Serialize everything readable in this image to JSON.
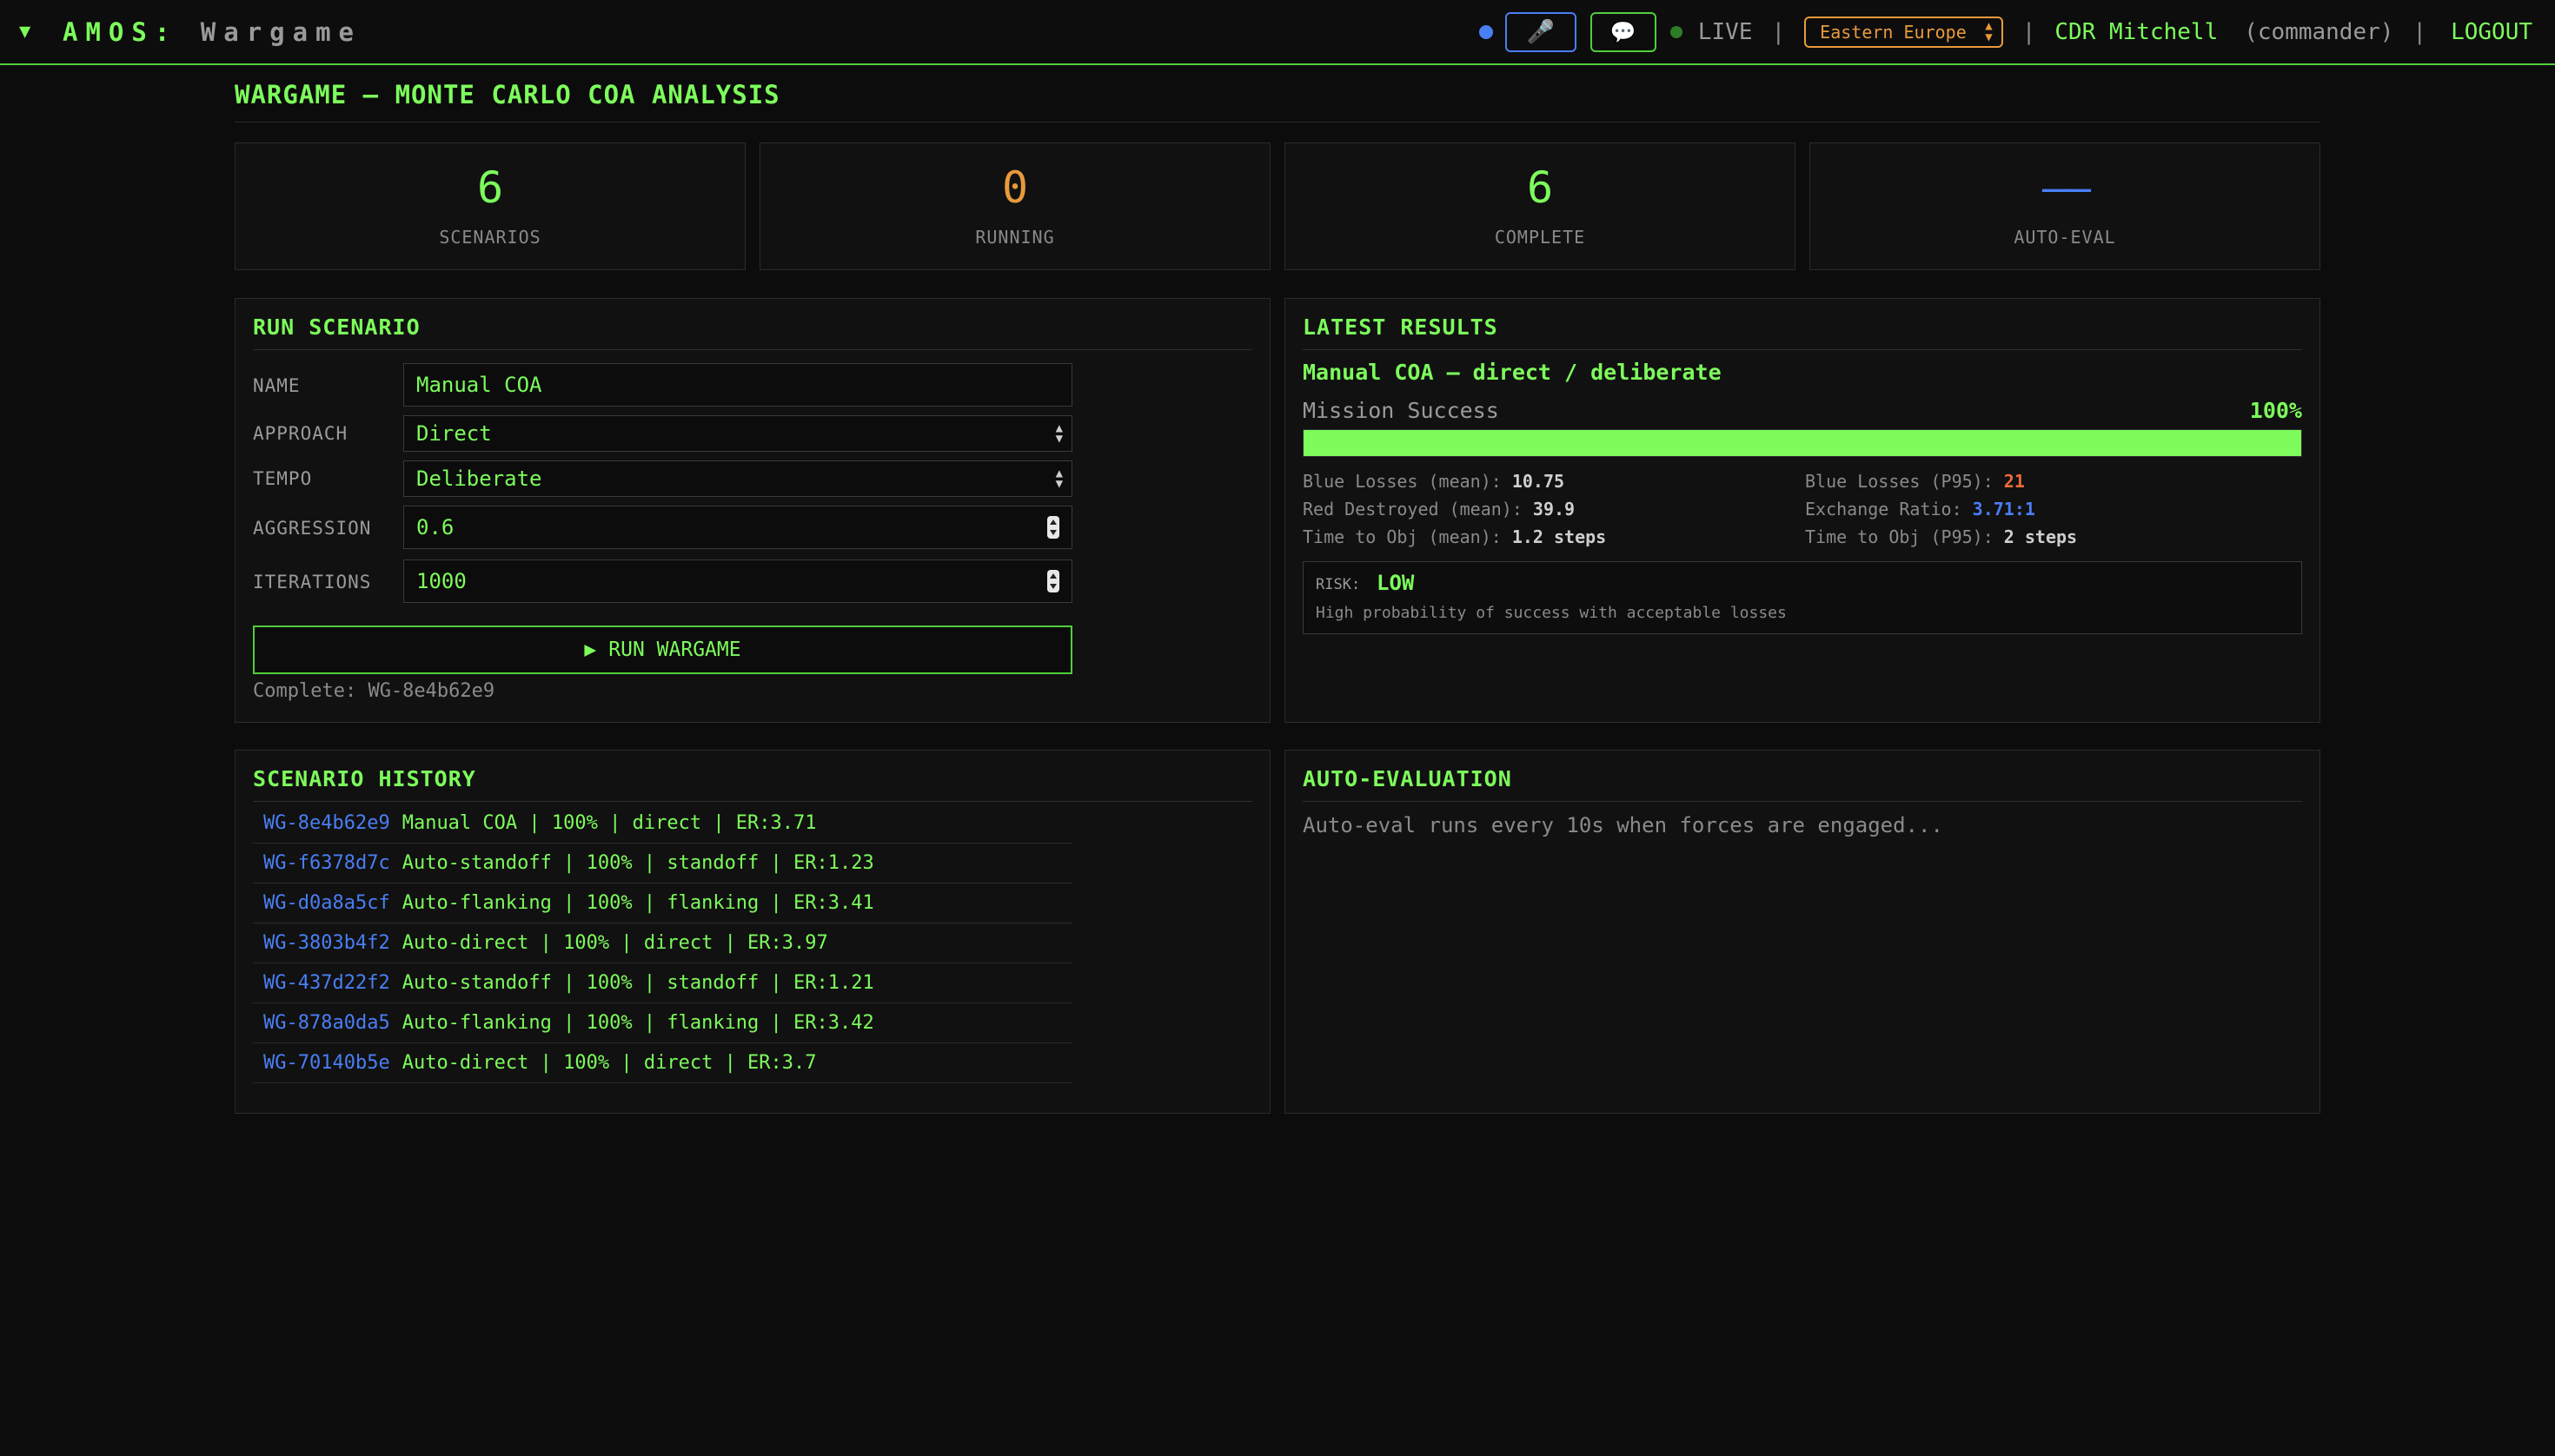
{
  "header": {
    "brand_name": "AMOS:",
    "brand_section": "Wargame",
    "live_label": "LIVE",
    "separator": "|",
    "region": "Eastern Europe",
    "user": "CDR Mitchell",
    "role": "(commander)",
    "logout_label": "LOGOUT",
    "collapse_glyph": "▼",
    "mic_glyph": "🎤",
    "chat_glyph": "💬"
  },
  "page": {
    "title": "WARGAME — MONTE CARLO COA ANALYSIS"
  },
  "stats": [
    {
      "value": "6",
      "label": "SCENARIOS",
      "color": "#7dfc5c"
    },
    {
      "value": "0",
      "label": "RUNNING",
      "color": "#e89a3c"
    },
    {
      "value": "6",
      "label": "COMPLETE",
      "color": "#7dfc5c"
    },
    {
      "value": "——",
      "label": "AUTO-EVAL",
      "color": "#4a7ef5"
    }
  ],
  "run": {
    "title": "RUN SCENARIO",
    "name_label": "NAME",
    "name_value": "Manual COA",
    "approach_label": "APPROACH",
    "approach_value": "Direct",
    "tempo_label": "TEMPO",
    "tempo_value": "Deliberate",
    "aggression_label": "AGGRESSION",
    "aggression_value": "0.6",
    "iterations_label": "ITERATIONS",
    "iterations_value": "1000",
    "run_glyph": "▶",
    "run_label": "RUN WARGAME",
    "status": "Complete: WG-8e4b62e9"
  },
  "results": {
    "title": "LATEST RESULTS",
    "coa": "Manual COA — direct / deliberate",
    "mission_label": "Mission Success",
    "mission_value": "100%",
    "mission_fraction": 1.0,
    "metrics": {
      "blue_mean_label": "Blue Losses (mean):",
      "blue_mean_value": "10.75",
      "blue_p95_label": "Blue Losses (P95):",
      "blue_p95_value": "21",
      "red_label": "Red Destroyed (mean):",
      "red_value": "39.9",
      "er_label": "Exchange Ratio:",
      "er_value": "3.71:1",
      "tto_mean_label": "Time to Obj (mean):",
      "tto_mean_value": "1.2 steps",
      "tto_p95_label": "Time to Obj (P95):",
      "tto_p95_value": "2 steps"
    },
    "risk_key": "RISK:",
    "risk_value": "LOW",
    "risk_desc": "High probability of success with acceptable losses"
  },
  "history": {
    "title": "SCENARIO HISTORY",
    "rows": [
      {
        "id": "WG-8e4b62e9",
        "text": "Manual COA | 100% | direct | ER:3.71"
      },
      {
        "id": "WG-f6378d7c",
        "text": "Auto-standoff | 100% | standoff | ER:1.23"
      },
      {
        "id": "WG-d0a8a5cf",
        "text": "Auto-flanking | 100% | flanking | ER:3.41"
      },
      {
        "id": "WG-3803b4f2",
        "text": "Auto-direct | 100% | direct | ER:3.97"
      },
      {
        "id": "WG-437d22f2",
        "text": "Auto-standoff | 100% | standoff | ER:1.21"
      },
      {
        "id": "WG-878a0da5",
        "text": "Auto-flanking | 100% | flanking | ER:3.42"
      },
      {
        "id": "WG-70140b5e",
        "text": "Auto-direct | 100% | direct | ER:3.7"
      }
    ]
  },
  "autoeval": {
    "title": "AUTO-EVALUATION",
    "text": "Auto-eval runs every 10s when forces are engaged..."
  },
  "colors": {
    "accent": "#7dfc5c",
    "warning": "#e89a3c",
    "info": "#4a7ef5",
    "alert": "#ef6a3a"
  }
}
